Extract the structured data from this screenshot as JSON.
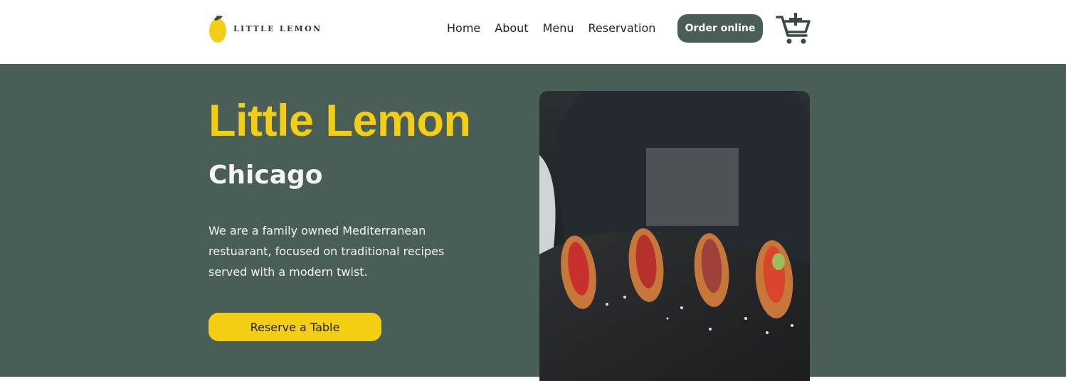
{
  "brand": {
    "name": "LITTLE LEMON",
    "accent": "#f4ce14",
    "primary": "#495e57"
  },
  "nav": {
    "items": [
      "Home",
      "About",
      "Menu",
      "Reservation"
    ]
  },
  "order_button": {
    "label": "Order online"
  },
  "cart": {
    "icon": "cart-plus-icon"
  },
  "hero": {
    "title": "Little Lemon",
    "city": "Chicago",
    "description": "We are a family owned Mediterranean restuarant, focused on traditional recipes served with a modern twist.",
    "reserve_label": "Reserve a Table",
    "image": "appetizers-on-slate-photo"
  }
}
